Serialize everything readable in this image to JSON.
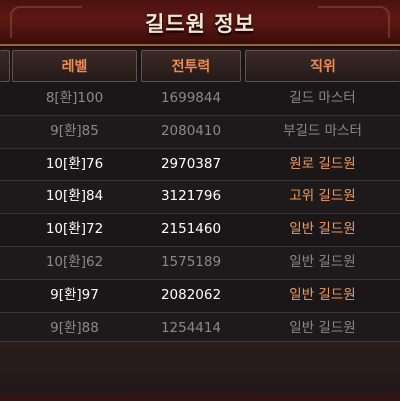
{
  "window": {
    "title": "길드원 정보"
  },
  "table": {
    "headers": [
      "레벨",
      "전투력",
      "직위"
    ],
    "rows": [
      {
        "level": "8[환]100",
        "power": "1699844",
        "rank": "길드 마스터",
        "online": false
      },
      {
        "level": "9[환]85",
        "power": "2080410",
        "rank": "부길드 마스터",
        "online": false
      },
      {
        "level": "10[환]76",
        "power": "2970387",
        "rank": "원로 길드원",
        "online": true
      },
      {
        "level": "10[환]84",
        "power": "3121796",
        "rank": "고위 길드원",
        "online": true
      },
      {
        "level": "10[환]72",
        "power": "2151460",
        "rank": "일반 길드원",
        "online": true
      },
      {
        "level": "10[환]62",
        "power": "1575189",
        "rank": "일반 길드원",
        "online": false
      },
      {
        "level": "9[환]97",
        "power": "2082062",
        "rank": "일반 길드원",
        "online": true
      },
      {
        "level": "9[환]88",
        "power": "1254414",
        "rank": "일반 길드원",
        "online": false
      }
    ]
  },
  "colors": {
    "header_text": "#ef8a52",
    "online_text": "#ffffff",
    "online_rank": "#f09a5e",
    "offline_text": "#8c8788"
  }
}
